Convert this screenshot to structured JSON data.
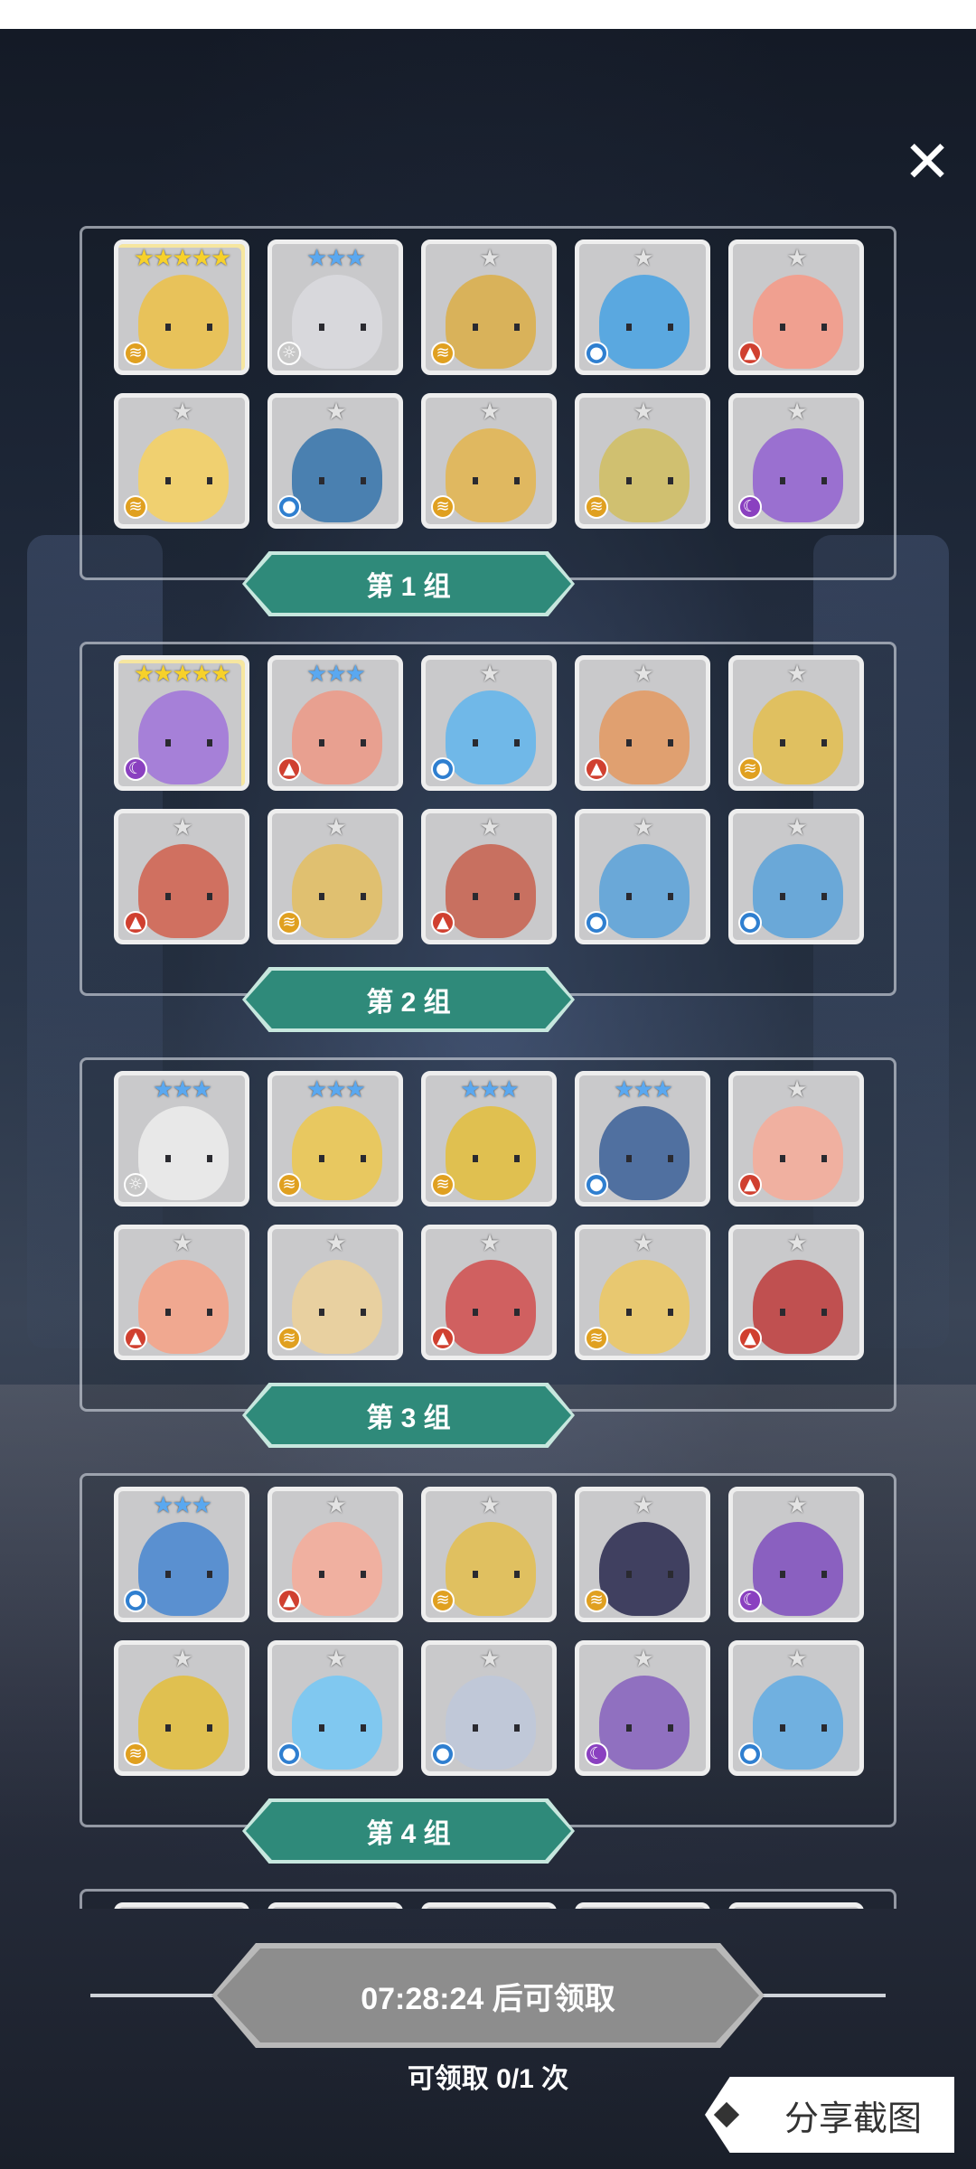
{
  "close_icon": "✕",
  "groups": [
    {
      "label": "第 1 组",
      "cards": [
        {
          "stars": "★★★★★",
          "tier": "s5",
          "element": "wind",
          "color": "#e8c25a"
        },
        {
          "stars": "★★★",
          "tier": "s3",
          "element": "light",
          "color": "#d8d8dc"
        },
        {
          "stars": "★",
          "tier": "s1",
          "element": "wind",
          "color": "#d9b25a"
        },
        {
          "stars": "★",
          "tier": "s1",
          "element": "water",
          "color": "#5aa8e0"
        },
        {
          "stars": "★",
          "tier": "s1",
          "element": "fire",
          "color": "#f0a090"
        },
        {
          "stars": "★",
          "tier": "s1",
          "element": "wind",
          "color": "#f0d070"
        },
        {
          "stars": "★",
          "tier": "s1",
          "element": "water",
          "color": "#4a80b0"
        },
        {
          "stars": "★",
          "tier": "s1",
          "element": "wind",
          "color": "#e0b860"
        },
        {
          "stars": "★",
          "tier": "s1",
          "element": "wind",
          "color": "#d0c070"
        },
        {
          "stars": "★",
          "tier": "s1",
          "element": "dark",
          "color": "#9a70d0"
        }
      ]
    },
    {
      "label": "第 2 组",
      "cards": [
        {
          "stars": "★★★★★",
          "tier": "s5",
          "element": "dark",
          "color": "#a680d8"
        },
        {
          "stars": "★★★",
          "tier": "s3",
          "element": "fire",
          "color": "#e8a090"
        },
        {
          "stars": "★",
          "tier": "s1",
          "element": "water",
          "color": "#70b8e8"
        },
        {
          "stars": "★",
          "tier": "s1",
          "element": "fire",
          "color": "#e0a070"
        },
        {
          "stars": "★",
          "tier": "s1",
          "element": "wind",
          "color": "#e0c060"
        },
        {
          "stars": "★",
          "tier": "s1",
          "element": "fire",
          "color": "#d07060"
        },
        {
          "stars": "★",
          "tier": "s1",
          "element": "wind",
          "color": "#e0c070"
        },
        {
          "stars": "★",
          "tier": "s1",
          "element": "fire",
          "color": "#c87060"
        },
        {
          "stars": "★",
          "tier": "s1",
          "element": "water",
          "color": "#6aa8d8"
        },
        {
          "stars": "★",
          "tier": "s1",
          "element": "water",
          "color": "#6aa8d8"
        }
      ]
    },
    {
      "label": "第 3 组",
      "cards": [
        {
          "stars": "★★★",
          "tier": "s3",
          "element": "light",
          "color": "#e8e8e8"
        },
        {
          "stars": "★★★",
          "tier": "s3",
          "element": "wind",
          "color": "#e8c860"
        },
        {
          "stars": "★★★",
          "tier": "s3",
          "element": "wind",
          "color": "#e0c050"
        },
        {
          "stars": "★★★",
          "tier": "s3",
          "element": "water",
          "color": "#5070a0"
        },
        {
          "stars": "★",
          "tier": "s1",
          "element": "fire",
          "color": "#f0b0a0"
        },
        {
          "stars": "★",
          "tier": "s1",
          "element": "fire",
          "color": "#f0a890"
        },
        {
          "stars": "★",
          "tier": "s1",
          "element": "wind",
          "color": "#e8d0a0"
        },
        {
          "stars": "★",
          "tier": "s1",
          "element": "fire",
          "color": "#d06060"
        },
        {
          "stars": "★",
          "tier": "s1",
          "element": "wind",
          "color": "#e8c870"
        },
        {
          "stars": "★",
          "tier": "s1",
          "element": "fire",
          "color": "#c05050"
        }
      ]
    },
    {
      "label": "第 4 组",
      "cards": [
        {
          "stars": "★★★",
          "tier": "s3",
          "element": "water",
          "color": "#5a90d0"
        },
        {
          "stars": "★",
          "tier": "s1",
          "element": "fire",
          "color": "#f0b0a0"
        },
        {
          "stars": "★",
          "tier": "s1",
          "element": "wind",
          "color": "#e0c060"
        },
        {
          "stars": "★",
          "tier": "s1",
          "element": "wind",
          "color": "#404060"
        },
        {
          "stars": "★",
          "tier": "s1",
          "element": "dark",
          "color": "#8a60c0"
        },
        {
          "stars": "★",
          "tier": "s1",
          "element": "wind",
          "color": "#e0c050"
        },
        {
          "stars": "★",
          "tier": "s1",
          "element": "water",
          "color": "#80c8f0"
        },
        {
          "stars": "★",
          "tier": "s1",
          "element": "water",
          "color": "#c0c8d8"
        },
        {
          "stars": "★",
          "tier": "s1",
          "element": "dark",
          "color": "#9070c0"
        },
        {
          "stars": "★",
          "tier": "s1",
          "element": "water",
          "color": "#70b0e0"
        }
      ]
    },
    {
      "label": "",
      "cards": [
        {
          "stars": "★",
          "tier": "s1",
          "element": "",
          "color": "#c9c9cb"
        },
        {
          "stars": "★",
          "tier": "s1",
          "element": "",
          "color": "#c9c9cb"
        },
        {
          "stars": "★",
          "tier": "s1",
          "element": "",
          "color": "#c9c9cb"
        },
        {
          "stars": "★",
          "tier": "s1",
          "element": "",
          "color": "#c9c9cb"
        },
        {
          "stars": "★",
          "tier": "s1",
          "element": "",
          "color": "#c9c9cb"
        }
      ]
    }
  ],
  "element_icons": {
    "wind": {
      "glyph": "≋",
      "color": "#e0a020"
    },
    "water": {
      "glyph": "●",
      "color": "#2f7fd0"
    },
    "fire": {
      "glyph": "▲",
      "color": "#d04030"
    },
    "light": {
      "glyph": "☼",
      "color": "#c8c8c8"
    },
    "dark": {
      "glyph": "☾",
      "color": "#8a40c0"
    }
  },
  "claim": {
    "button_label": "07:28:24 后可领取",
    "count_text": "可领取 0/1 次"
  },
  "share": {
    "label": "分享截图"
  }
}
